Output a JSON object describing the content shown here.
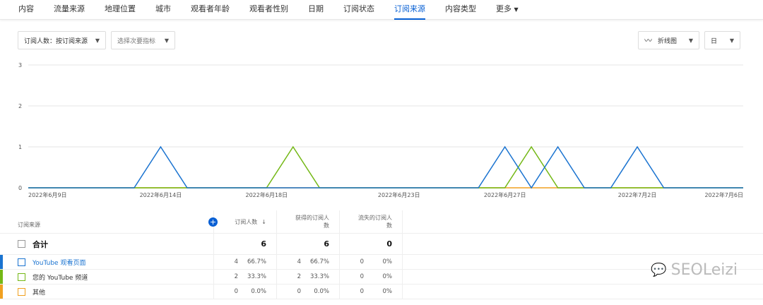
{
  "tabs": [
    "内容",
    "流量来源",
    "地理位置",
    "城市",
    "观看者年龄",
    "观看者性别",
    "日期",
    "订阅状态",
    "订阅来源",
    "内容类型",
    "更多"
  ],
  "active_tab": "订阅来源",
  "controls": {
    "metric": "订阅人数：按订阅来源",
    "secondary": "选择次要指标",
    "chart_type": "折线图",
    "period": "日"
  },
  "chart_data": {
    "type": "line",
    "x": [
      "2022-06-09",
      "2022-07-06"
    ],
    "x_tick_labels": [
      "2022年6月9日",
      "2022年6月14日",
      "2022年6月18日",
      "2022年6月23日",
      "2022年6月27日",
      "2022年7月2日",
      "2022年7月6日"
    ],
    "x_tick_days": [
      0,
      5,
      9,
      14,
      18,
      23,
      27
    ],
    "y_ticks": [
      "0",
      "1",
      "2",
      "3"
    ],
    "ylim": [
      0,
      3
    ],
    "num_days": 28,
    "series": [
      {
        "name": "YouTube 观看页面",
        "color": "#1a73d0",
        "peaks": {
          "5": 1,
          "18": 1,
          "20": 1,
          "23": 1
        }
      },
      {
        "name": "您的 YouTube 频道",
        "color": "#74b816",
        "peaks": {
          "10": 1,
          "19": 1
        }
      },
      {
        "name": "其他",
        "color": "#f0a020",
        "peaks": {}
      }
    ]
  },
  "table": {
    "headers": [
      "订阅来源",
      "订阅人数",
      "获得的订阅人数",
      "流失的订阅人数"
    ],
    "total": {
      "label": "合计",
      "values": [
        "6",
        "6",
        "0"
      ]
    },
    "rows": [
      {
        "label": "YouTube 观看页面",
        "color": "#1a73d0",
        "cells": [
          [
            "4",
            "66.7%"
          ],
          [
            "4",
            "66.7%"
          ],
          [
            "0",
            "0%"
          ]
        ]
      },
      {
        "label": "您的 YouTube 频道",
        "color": "#74b816",
        "cells": [
          [
            "2",
            "33.3%"
          ],
          [
            "2",
            "33.3%"
          ],
          [
            "0",
            "0%"
          ]
        ]
      },
      {
        "label": "其他",
        "color": "#f0a020",
        "cells": [
          [
            "0",
            "0.0%"
          ],
          [
            "0",
            "0.0%"
          ],
          [
            "0",
            "0%"
          ]
        ]
      }
    ]
  },
  "watermark": "SEOLeizi"
}
